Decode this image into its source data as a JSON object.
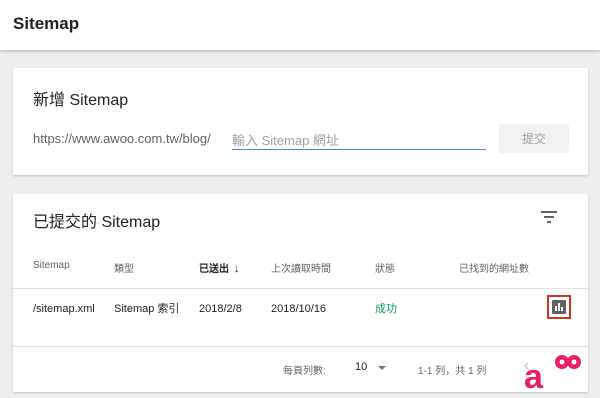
{
  "page": {
    "title": "Sitemap"
  },
  "add_sitemap": {
    "heading": "新增 Sitemap",
    "url_prefix": "https://www.awoo.com.tw/blog/",
    "input_placeholder": "輸入 Sitemap 網址",
    "submit_label": "提交"
  },
  "submitted": {
    "heading": "已提交的 Sitemap",
    "filter_icon": "filter-icon",
    "columns": {
      "sitemap": "Sitemap",
      "type": "類型",
      "submitted": "已送出",
      "last_read": "上次讀取時間",
      "status": "狀態",
      "urls_found": "已找到的網址數"
    },
    "sort_icon": "arrow-down-icon",
    "rows": [
      {
        "sitemap": "/sitemap.xml",
        "type": "Sitemap 索引",
        "submitted": "2018/2/8",
        "last_read": "2018/10/16",
        "status": "成功",
        "action_icon": "bar-chart-icon"
      }
    ],
    "pagination": {
      "rows_per_page_label": "每頁列數:",
      "rows_per_page_value": "10",
      "range_text": "1-1 列，共 1 列"
    }
  },
  "colors": {
    "status_success": "#0f9d58",
    "input_underline": "#4285f4",
    "highlight_border": "#d93025",
    "logo": "#e91e63"
  },
  "logo": {
    "text": "a"
  }
}
